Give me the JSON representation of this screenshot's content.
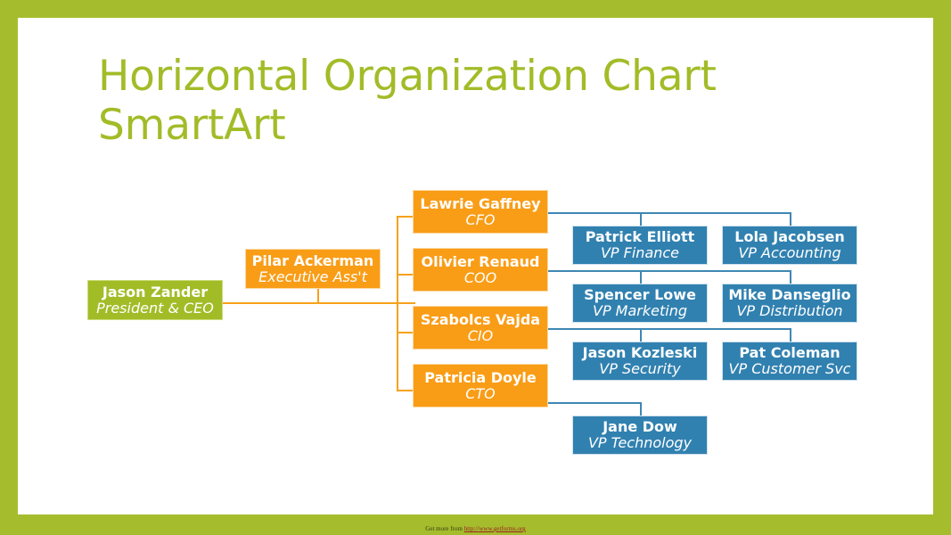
{
  "slide": {
    "title": "Horizontal Organization Chart\nSmartArt",
    "frame_color": "#a5bd2d",
    "background": "#ffffff"
  },
  "footer": {
    "prefix": "Get more from ",
    "url": "http://www.getforms.org"
  },
  "colors": {
    "green": "#a2bc28",
    "orange": "#f99d17",
    "blue": "#3181b0",
    "connector_orange": "#f6a11b",
    "connector_blue": "#3e87b3",
    "title_green": "#a2bc28"
  },
  "chart_data": {
    "type": "diagram",
    "diagram_type": "horizontal-organization-chart",
    "title": "Horizontal Organization Chart SmartArt",
    "nodes": [
      {
        "id": "ceo",
        "name": "Jason Zander",
        "title": "President & CEO",
        "level": 0,
        "color": "#a2bc28",
        "role": "root"
      },
      {
        "id": "assistant",
        "name": "Pilar Ackerman",
        "title": "Executive Ass't",
        "level": 1,
        "color": "#f99d17",
        "role": "assistant"
      },
      {
        "id": "cfo",
        "name": "Lawrie Gaffney",
        "title": "CFO",
        "level": 1,
        "color": "#f99d17",
        "role": "manager"
      },
      {
        "id": "coo",
        "name": "Olivier Renaud",
        "title": "COO",
        "level": 1,
        "color": "#f99d17",
        "role": "manager"
      },
      {
        "id": "cio",
        "name": "Szabolcs Vajda",
        "title": "CIO",
        "level": 1,
        "color": "#f99d17",
        "role": "manager"
      },
      {
        "id": "cto",
        "name": "Patricia Doyle",
        "title": "CTO",
        "level": 1,
        "color": "#f99d17",
        "role": "manager"
      },
      {
        "id": "vp_finance",
        "name": "Patrick Elliott",
        "title": "VP Finance",
        "level": 2,
        "color": "#3181b0",
        "role": "report"
      },
      {
        "id": "vp_accounting",
        "name": "Lola Jacobsen",
        "title": "VP Accounting",
        "level": 2,
        "color": "#3181b0",
        "role": "report"
      },
      {
        "id": "vp_marketing",
        "name": "Spencer Lowe",
        "title": "VP Marketing",
        "level": 2,
        "color": "#3181b0",
        "role": "report"
      },
      {
        "id": "vp_distribution",
        "name": "Mike Danseglio",
        "title": "VP Distribution",
        "level": 2,
        "color": "#3181b0",
        "role": "report"
      },
      {
        "id": "vp_security",
        "name": "Jason Kozleski",
        "title": "VP Security",
        "level": 2,
        "color": "#3181b0",
        "role": "report"
      },
      {
        "id": "vp_customer",
        "name": "Pat Coleman",
        "title": "VP Customer Svc",
        "level": 2,
        "color": "#3181b0",
        "role": "report"
      },
      {
        "id": "vp_technology",
        "name": "Jane Dow",
        "title": "VP Technology",
        "level": 2,
        "color": "#3181b0",
        "role": "report"
      }
    ],
    "edges": [
      {
        "from": "ceo",
        "to": "assistant"
      },
      {
        "from": "ceo",
        "to": "cfo"
      },
      {
        "from": "ceo",
        "to": "coo"
      },
      {
        "from": "ceo",
        "to": "cio"
      },
      {
        "from": "ceo",
        "to": "cto"
      },
      {
        "from": "cfo",
        "to": "vp_finance"
      },
      {
        "from": "cfo",
        "to": "vp_accounting"
      },
      {
        "from": "coo",
        "to": "vp_marketing"
      },
      {
        "from": "coo",
        "to": "vp_distribution"
      },
      {
        "from": "cio",
        "to": "vp_security"
      },
      {
        "from": "cio",
        "to": "vp_customer"
      },
      {
        "from": "cto",
        "to": "vp_technology"
      }
    ]
  }
}
